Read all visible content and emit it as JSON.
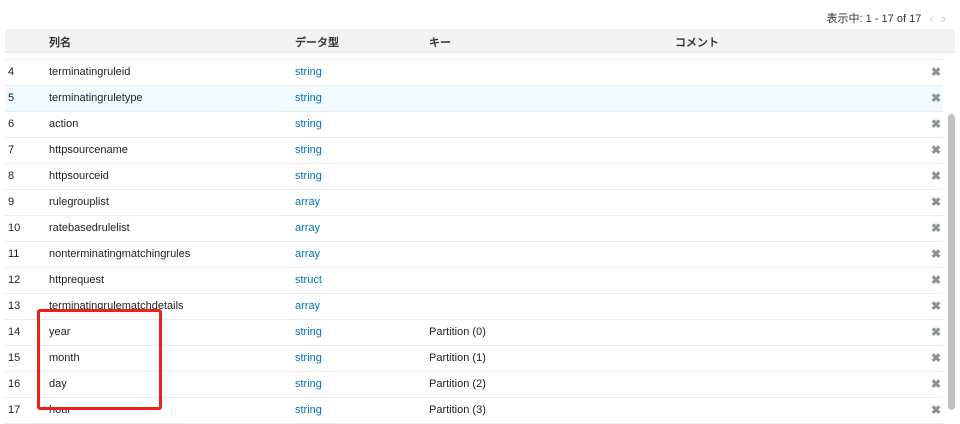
{
  "pager": {
    "text": "表示中: 1 - 17 of 17",
    "prev": "‹",
    "next": "›"
  },
  "columns": {
    "name": "列名",
    "type": "データ型",
    "key": "キー",
    "comment": "コメント"
  },
  "rows": [
    {
      "num": "4",
      "name": "terminatingruleid",
      "type": "string",
      "key": ""
    },
    {
      "num": "5",
      "name": "terminatingruletype",
      "type": "string",
      "key": ""
    },
    {
      "num": "6",
      "name": "action",
      "type": "string",
      "key": ""
    },
    {
      "num": "7",
      "name": "httpsourcename",
      "type": "string",
      "key": ""
    },
    {
      "num": "8",
      "name": "httpsourceid",
      "type": "string",
      "key": ""
    },
    {
      "num": "9",
      "name": "rulegrouplist",
      "type": "array",
      "key": ""
    },
    {
      "num": "10",
      "name": "ratebasedrulelist",
      "type": "array",
      "key": ""
    },
    {
      "num": "11",
      "name": "nonterminatingmatchingrules",
      "type": "array",
      "key": ""
    },
    {
      "num": "12",
      "name": "httprequest",
      "type": "struct",
      "key": ""
    },
    {
      "num": "13",
      "name": "terminatingrulematchdetails",
      "type": "array",
      "key": ""
    },
    {
      "num": "14",
      "name": "year",
      "type": "string",
      "key": "Partition (0)"
    },
    {
      "num": "15",
      "name": "month",
      "type": "string",
      "key": "Partition (1)"
    },
    {
      "num": "16",
      "name": "day",
      "type": "string",
      "key": "Partition (2)"
    },
    {
      "num": "17",
      "name": "hour",
      "type": "string",
      "key": "Partition (3)"
    }
  ],
  "delete_glyph": "✖",
  "highlight_color": "#e8231b",
  "link_color": "#0073bb",
  "icons": {
    "delete": "close-icon",
    "prev": "chevron-left-icon",
    "next": "chevron-right-icon"
  }
}
